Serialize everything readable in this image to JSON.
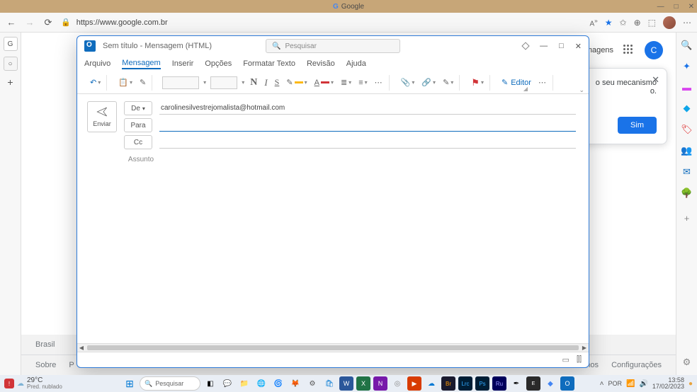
{
  "browser": {
    "title": "Google",
    "url": "https://www.google.com.br",
    "win_min": "—",
    "win_max": "□",
    "win_close": "✕",
    "tab_label": "G",
    "right_icons": [
      "A\\",
      "★",
      "✩",
      "⊕",
      "⬚"
    ]
  },
  "google": {
    "images_link": "Imagens",
    "avatar_letter": "C",
    "footer_country": "Brasil",
    "footer_links_left": [
      "Sobre",
      "P"
    ],
    "footer_links_right": [
      "rmos",
      "Configurações"
    ],
    "popup_text": "o seu mecanismo",
    "popup_text2": "o.",
    "popup_button": "Sim",
    "popup_close": "✕"
  },
  "outlook": {
    "title": "Sem título  -  Mensagem (HTML)",
    "search_placeholder": "Pesquisar",
    "menu": [
      "Arquivo",
      "Mensagem",
      "Inserir",
      "Opções",
      "Formatar Texto",
      "Revisão",
      "Ajuda"
    ],
    "menu_active_index": 1,
    "ribbon": {
      "undo": "↶",
      "paste": "📋",
      "brush": "✎",
      "bold": "N",
      "italic": "I",
      "underline": "S",
      "bullets": "≣",
      "numbers": "≡",
      "more": "⋯",
      "attach": "📎",
      "link": "🔗",
      "sign": "✎",
      "flag": "⚑",
      "editor_label": "Editor",
      "ellipsis": "⋯"
    },
    "send_label": "Enviar",
    "from_label": "De",
    "from_value": "carolinesilvestrejomalista@hotmail.com",
    "to_label": "Para",
    "to_value": "",
    "cc_label": "Cc",
    "cc_value": "",
    "subject_label": "Assunto",
    "subject_value": ""
  },
  "taskbar": {
    "weather_badge": "!",
    "temp": "29°C",
    "weather_label": "Pred. nublado",
    "search_placeholder": "Pesquisar",
    "time": "13:58",
    "date": "17/02/2023"
  },
  "sidebar_colors": [
    "#1a73e8",
    "#d946ef",
    "#0ea5e9",
    "#dc2626",
    "#16a34a",
    "#2563eb",
    "#15803d"
  ]
}
